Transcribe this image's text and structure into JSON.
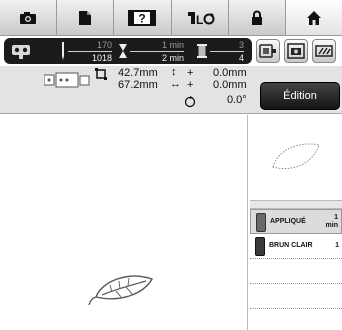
{
  "tabs": [
    {
      "name": "camera-icon",
      "active": false
    },
    {
      "name": "document-icon",
      "active": false
    },
    {
      "name": "help-icon",
      "label": "?",
      "active": false
    },
    {
      "name": "thread-cut-icon",
      "active": false
    },
    {
      "name": "lock-icon",
      "active": false
    },
    {
      "name": "home-icon",
      "active": true
    }
  ],
  "status": {
    "stitch_current": "170",
    "stitch_total": "1018",
    "time_current": "1 min",
    "time_total": "2 min",
    "color_current": "3",
    "color_total": "4"
  },
  "right_buttons": [
    "frame-select-icon",
    "camera-frame-icon",
    "needle-position-icon"
  ],
  "info": {
    "width": "42.7mm",
    "height": "67.2mm",
    "offset_vertical": "0.0mm",
    "offset_horizontal": "0.0mm",
    "rotation": "0.0°",
    "plus_sign": "+"
  },
  "edit_button": "Édition",
  "threads": [
    {
      "name": "APPLIQUÉ",
      "count": "1",
      "unit": "min",
      "color": "#6a6a6a",
      "selected": true
    },
    {
      "name": "BRUN CLAIR",
      "count": "1",
      "unit": "",
      "color": "#3a3a3a",
      "selected": false
    }
  ],
  "colors": {
    "statusbar": "#1b1b1b",
    "info_bg": "#e3e3e3",
    "edit_button_bg": "#141414"
  }
}
